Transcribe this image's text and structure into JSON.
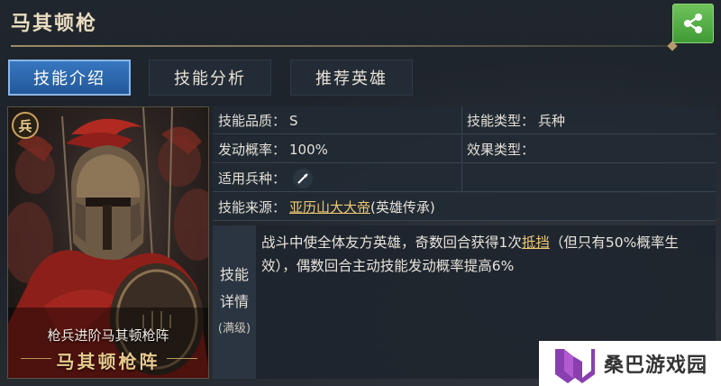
{
  "header": {
    "title": "马其顿枪"
  },
  "tabs": [
    {
      "label": "技能介绍",
      "active": true
    },
    {
      "label": "技能分析",
      "active": false
    },
    {
      "label": "推荐英雄",
      "active": false
    }
  ],
  "card": {
    "badge": "兵",
    "subtitle": "枪兵进阶马其顿枪阵",
    "name": "马其顿枪阵"
  },
  "info": {
    "quality_label": "技能品质：",
    "quality_value": "S",
    "type_label": "技能类型：",
    "type_value": "兵种",
    "rate_label": "发动概率：",
    "rate_value": "100%",
    "effect_label": "效果类型：",
    "effect_value": "",
    "troop_label": "适用兵种：",
    "troop_icon": "spear-icon",
    "source_label": "技能来源：",
    "source_link": "亚历山大大帝",
    "source_suffix": "(英雄传承)"
  },
  "detail": {
    "label_line1": "技能",
    "label_line2": "详情",
    "label_note": "(满级)",
    "text_before": "战斗中使全体友方英雄，奇数回合获得1次",
    "text_link": "抵挡",
    "text_after": "（但只有50%概率生效），偶数回合主动技能发动概率提高6%"
  },
  "watermark": {
    "text": "桑巴游戏园"
  },
  "colors": {
    "accent": "#2f6fb5",
    "gold": "#f0c872",
    "share_green": "#4caf3f"
  }
}
